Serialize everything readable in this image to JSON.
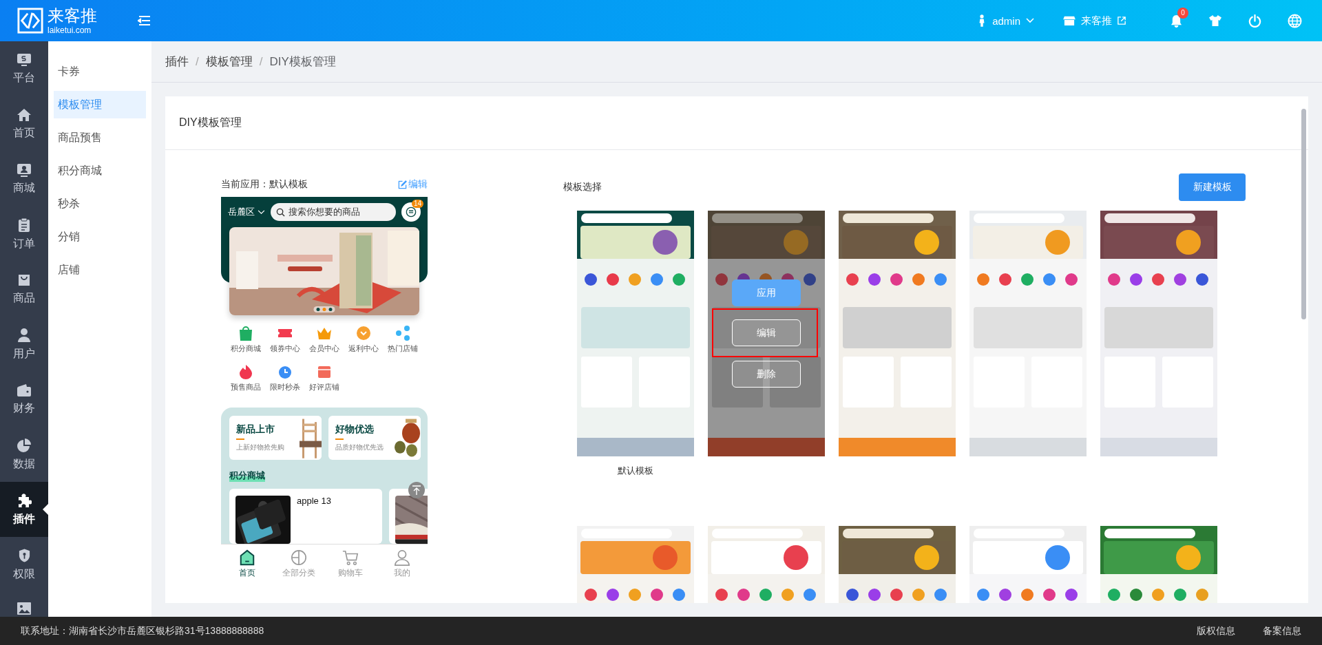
{
  "topbar": {
    "logo_title": "来客推",
    "logo_subtitle": "laiketui.com",
    "user": "admin",
    "store": "来客推",
    "notification_count": "0"
  },
  "nav": [
    {
      "label": "平台",
      "selected": false
    },
    {
      "label": "首页",
      "selected": false
    },
    {
      "label": "商城",
      "selected": false
    },
    {
      "label": "订单",
      "selected": false
    },
    {
      "label": "商品",
      "selected": false
    },
    {
      "label": "用户",
      "selected": false
    },
    {
      "label": "财务",
      "selected": false
    },
    {
      "label": "数据",
      "selected": false
    },
    {
      "label": "插件",
      "selected": true
    },
    {
      "label": "权限",
      "selected": false
    },
    {
      "selected": false
    }
  ],
  "subnav": [
    {
      "label": "卡券",
      "selected": false
    },
    {
      "label": "模板管理",
      "selected": true
    },
    {
      "label": "商品预售",
      "selected": false
    },
    {
      "label": "积分商城",
      "selected": false
    },
    {
      "label": "秒杀",
      "selected": false
    },
    {
      "label": "分销",
      "selected": false
    },
    {
      "label": "店铺",
      "selected": false
    }
  ],
  "breadcrumb": {
    "separator": "/",
    "items": [
      "插件",
      "模板管理",
      "DIY模板管理"
    ]
  },
  "card_title": "DIY模板管理",
  "current": {
    "label": "当前应用：默认模板",
    "edit": "编辑"
  },
  "phone": {
    "location": "岳麓区",
    "search_placeholder": "搜索你想要的商品",
    "message_badge": "14",
    "shortcuts": [
      "积分商城",
      "领券中心",
      "会员中心",
      "返利中心",
      "热门店铺",
      "预售商品",
      "限时秒杀",
      "好评店铺"
    ],
    "promos": [
      {
        "title": "新品上市",
        "subtitle": "上新好物抢先购"
      },
      {
        "title": "好物优选",
        "subtitle": "品质好物优先选"
      }
    ],
    "section_title": "积分商城",
    "product": "apple 13",
    "tabs": [
      {
        "label": "首页",
        "selected": true
      },
      {
        "label": "全部分类",
        "selected": false
      },
      {
        "label": "购物车",
        "selected": false
      },
      {
        "label": "我的",
        "selected": false
      }
    ]
  },
  "templates": {
    "title": "模板选择",
    "new_button": "新建模板",
    "actions": [
      "应用",
      "编辑",
      "删除"
    ],
    "items": [
      {
        "label": "默认模板",
        "hovered": false
      },
      {
        "hovered": true
      },
      {
        "hovered": false
      },
      {
        "hovered": false
      },
      {
        "hovered": false
      },
      {
        "hovered": false
      },
      {
        "hovered": false
      },
      {
        "hovered": false
      },
      {
        "hovered": false
      },
      {
        "hovered": false
      }
    ]
  },
  "footer": {
    "address": "联系地址：湖南省长沙市岳麓区银杉路31号13888888888",
    "links": [
      "版权信息",
      "备案信息"
    ]
  }
}
